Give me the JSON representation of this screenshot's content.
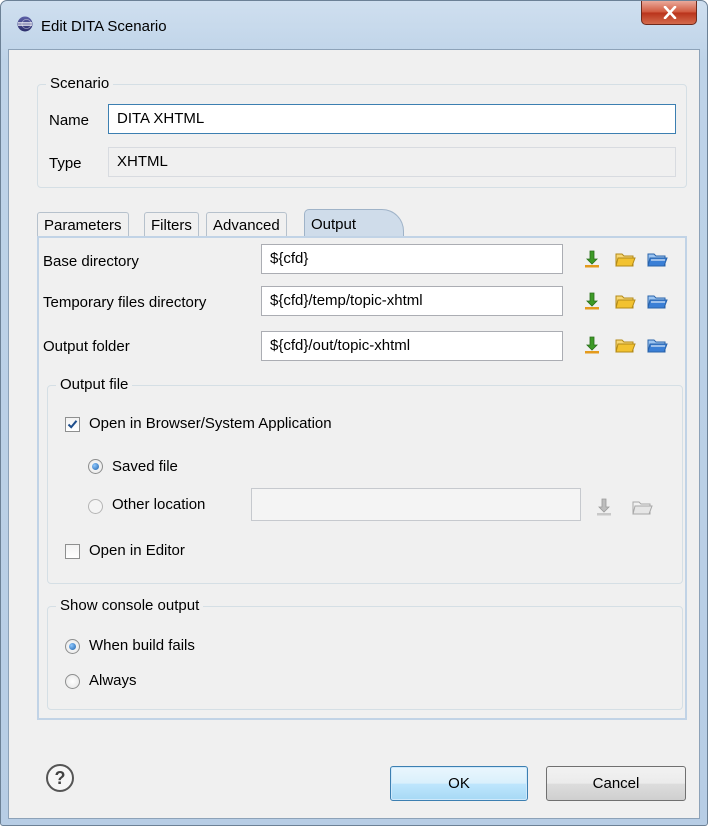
{
  "window": {
    "title": "Edit DITA Scenario",
    "close_glyph": "X"
  },
  "scenario": {
    "legend": "Scenario",
    "name_label": "Name",
    "name_value": "DITA XHTML",
    "type_label": "Type",
    "type_value": "XHTML"
  },
  "tabs": [
    {
      "label": "Parameters",
      "active": false
    },
    {
      "label": "Filters",
      "active": false
    },
    {
      "label": "Advanced",
      "active": false
    },
    {
      "label": "Output",
      "active": true
    }
  ],
  "output_tab": {
    "base_dir_label": "Base directory",
    "base_dir_value": "${cfd}",
    "temp_dir_label": "Temporary files directory",
    "temp_dir_value": "${cfd}/temp/topic-xhtml",
    "out_folder_label": "Output folder",
    "out_folder_value": "${cfd}/out/topic-xhtml",
    "output_file": {
      "legend": "Output file",
      "open_browser_label": "Open in Browser/System Application",
      "open_browser_checked": true,
      "saved_file_label": "Saved file",
      "saved_file_selected": true,
      "other_location_label": "Other location",
      "other_location_value": "",
      "open_editor_label": "Open in Editor",
      "open_editor_checked": false
    },
    "console": {
      "legend": "Show console output",
      "when_fails_label": "When build fails",
      "when_fails_selected": true,
      "always_label": "Always",
      "always_selected": false
    }
  },
  "footer": {
    "help_glyph": "?",
    "ok_label": "OK",
    "cancel_label": "Cancel"
  },
  "colors": {
    "accent": "#3c7fb1",
    "title_bar": "#bed3e8",
    "close_red": "#c7452b",
    "folder_yellow": "#f2c230",
    "folder_blue": "#3a7fd6",
    "insert_green": "#3d9a27"
  }
}
